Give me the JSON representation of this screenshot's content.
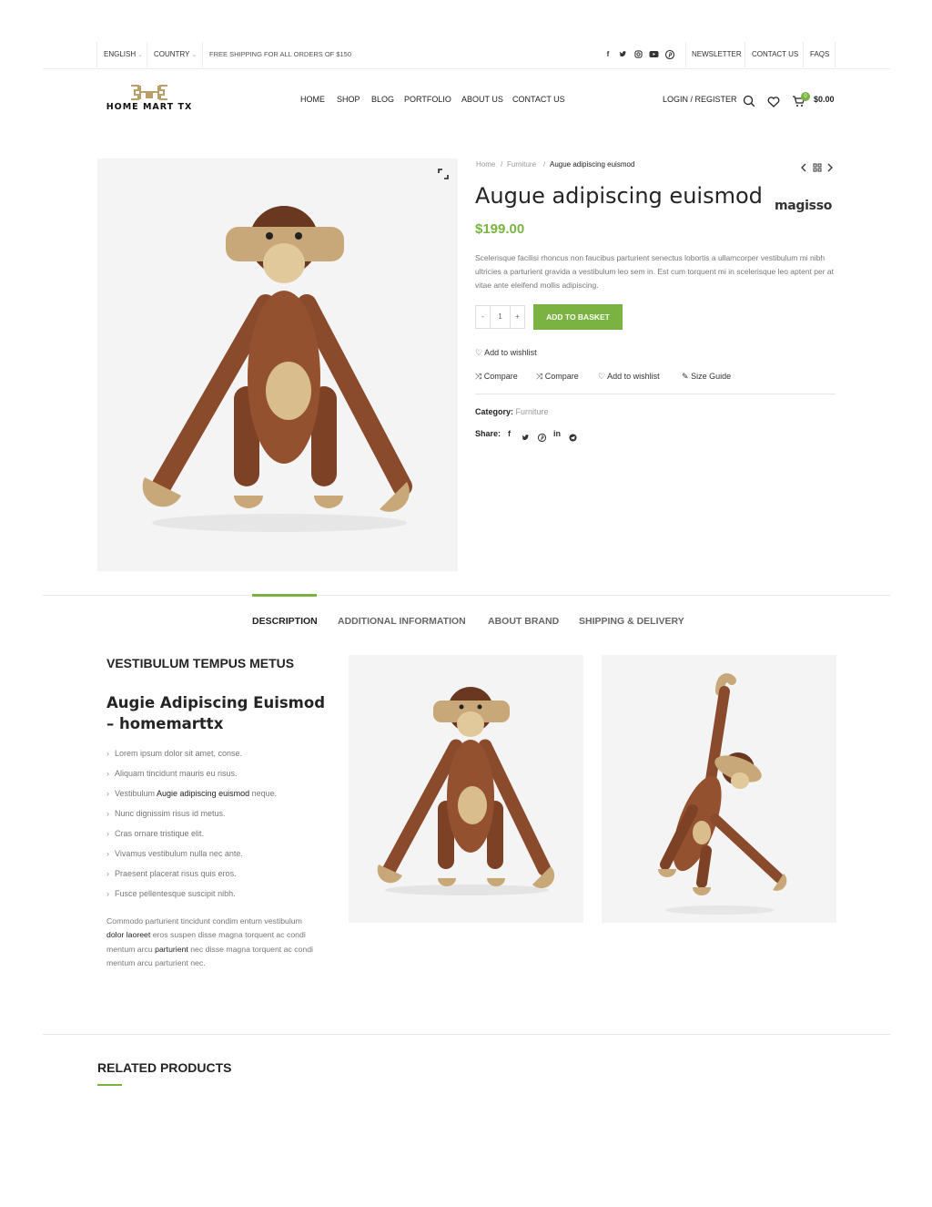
{
  "topbar": {
    "language": "ENGLISH",
    "country": "COUNTRY",
    "shipping_note": "FREE SHIPPING FOR ALL ORDERS OF $150",
    "social_icons": [
      "facebook-icon",
      "twitter-icon",
      "instagram-icon",
      "youtube-icon",
      "pinterest-icon"
    ],
    "links": [
      "NEWSLETTER",
      "CONTACT US",
      "FAQS"
    ]
  },
  "header": {
    "logo_text": "HOME MART TX",
    "nav": [
      "HOME",
      "SHOP",
      "BLOG",
      "PORTFOLIO",
      "ABOUT US",
      "CONTACT US"
    ],
    "login_label": "LOGIN / REGISTER",
    "cart_count": "0",
    "cart_total": "$0.00"
  },
  "breadcrumb": {
    "items": [
      "Home",
      "Furniture",
      "Augue adipiscing euismod"
    ],
    "separator": "/"
  },
  "product": {
    "title": "Augue adipiscing euismod",
    "brand": "magisso",
    "price": "$199.00",
    "description": "Scelerisque facilisi rhoncus non faucibus parturient senectus lobortis a ullamcorper vestibulum mi nibh ultricies a parturient gravida a vestibulum leo sem in. Est cum torquent mi in scelerisque leo aptent per at vitae ante eleifend mollis adipiscing.",
    "qty_minus": "-",
    "qty_value": "1",
    "qty_plus": "+",
    "add_to_basket": "ADD TO BASKET",
    "wishlist_label": "Add to wishlist",
    "actions": [
      "Compare",
      "Compare",
      "Add to wishlist",
      "Size Guide"
    ],
    "category_label": "Category:",
    "category_value": "Furniture",
    "share_label": "Share:",
    "share_icons": [
      "facebook-icon",
      "twitter-icon",
      "pinterest-icon",
      "linkedin-icon",
      "telegram-icon"
    ]
  },
  "tabs": [
    "DESCRIPTION",
    "ADDITIONAL INFORMATION",
    "ABOUT BRAND",
    "SHIPPING & DELIVERY"
  ],
  "description": {
    "heading": "VESTIBULUM TEMPUS METUS",
    "subheading": "Augie Adipiscing Euismod – homemarttx",
    "list": [
      "Lorem ipsum dolor sit amet, conse.",
      "Aliquam tincidunt mauris eu risus.",
      {
        "pre": "Vestibulum ",
        "strong": "Augie adipiscing euismod",
        "post": " neque."
      },
      "Nunc dignissim risus id metus.",
      "Cras ornare tristique elit.",
      "Vivamus vestibulum nulla nec ante.",
      "Praesent placerat risus quis eros.",
      "Fusce pellentesque suscipit nibh."
    ],
    "paragraph": {
      "p1": "Commodo parturient tincidunt condim entum vestibulum ",
      "s1": "dolor laoreet",
      "p2": " eros suspen disse magna torquent ac condi mentum arcu ",
      "s2": "parturient",
      "p3": " nec disse magna torquent ac condi mentum arcu parturient nec."
    }
  },
  "related": {
    "heading": "RELATED PRODUCTS"
  },
  "colors": {
    "accent": "#7ab342",
    "wood_dark": "#8a4a2c",
    "wood_light": "#c8a878"
  }
}
